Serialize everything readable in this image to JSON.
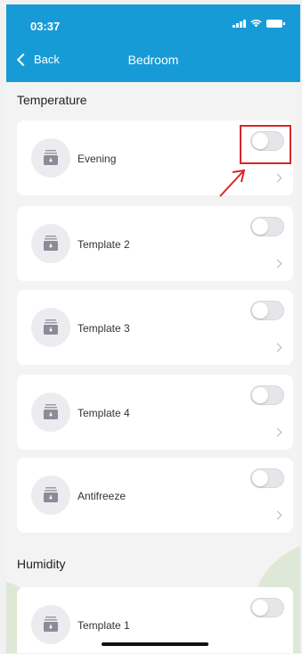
{
  "status": {
    "time": "03:37"
  },
  "header": {
    "back_label": "Back",
    "title": "Bedroom"
  },
  "sections": {
    "temperature": {
      "title": "Temperature",
      "items": [
        {
          "label": "Evening",
          "enabled": false
        },
        {
          "label": "Template 2",
          "enabled": false
        },
        {
          "label": "Template 3",
          "enabled": false
        },
        {
          "label": "Template 4",
          "enabled": false
        },
        {
          "label": "Antifreeze",
          "enabled": false
        }
      ]
    },
    "humidity": {
      "title": "Humidity",
      "items": [
        {
          "label": "Template 1",
          "enabled": false
        }
      ]
    }
  },
  "icons": {
    "row_icon": "heater-icon",
    "toggle": "toggle-switch",
    "row_chevron": "chevron-right-icon"
  },
  "colors": {
    "header": "#179bd7",
    "annotation": "#d7272b"
  }
}
